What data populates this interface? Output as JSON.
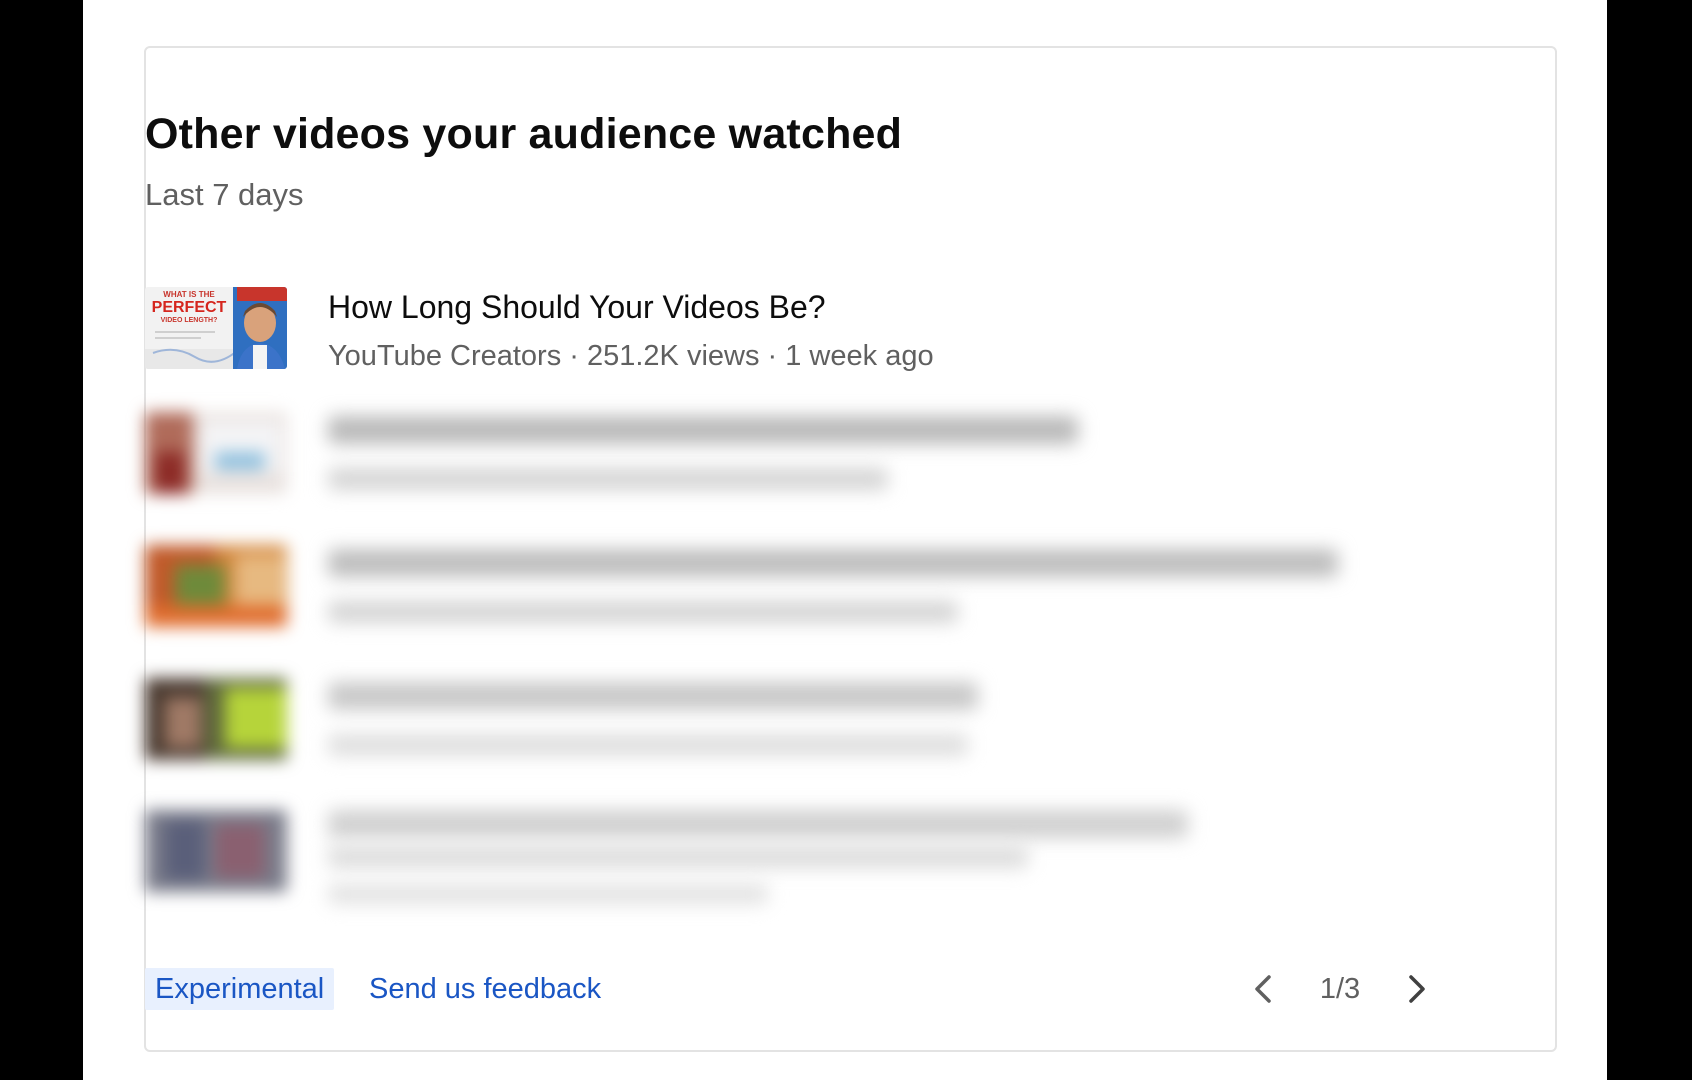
{
  "card": {
    "title": "Other videos your audience watched",
    "subtitle": "Last 7 days"
  },
  "videos": [
    {
      "title": "How Long Should Your Videos Be?",
      "meta": "YouTube Creators · 251.2K views · 1 week ago",
      "thumbnail_text": [
        "WHAT IS THE",
        "PERFECT",
        "VIDEO LENGTH?"
      ],
      "blurred": false
    },
    {
      "blurred": true
    },
    {
      "blurred": true
    },
    {
      "blurred": true
    },
    {
      "blurred": true
    }
  ],
  "footer": {
    "badge": "Experimental",
    "feedback_link": "Send us feedback",
    "page_indicator": "1/3"
  },
  "colors": {
    "link_blue": "#1a56c4",
    "badge_bg": "#e8f0fe",
    "secondary_text": "#606060",
    "primary_text": "#0d0d0d"
  },
  "icons": {
    "prev": "chevron-left-icon",
    "next": "chevron-right-icon"
  }
}
